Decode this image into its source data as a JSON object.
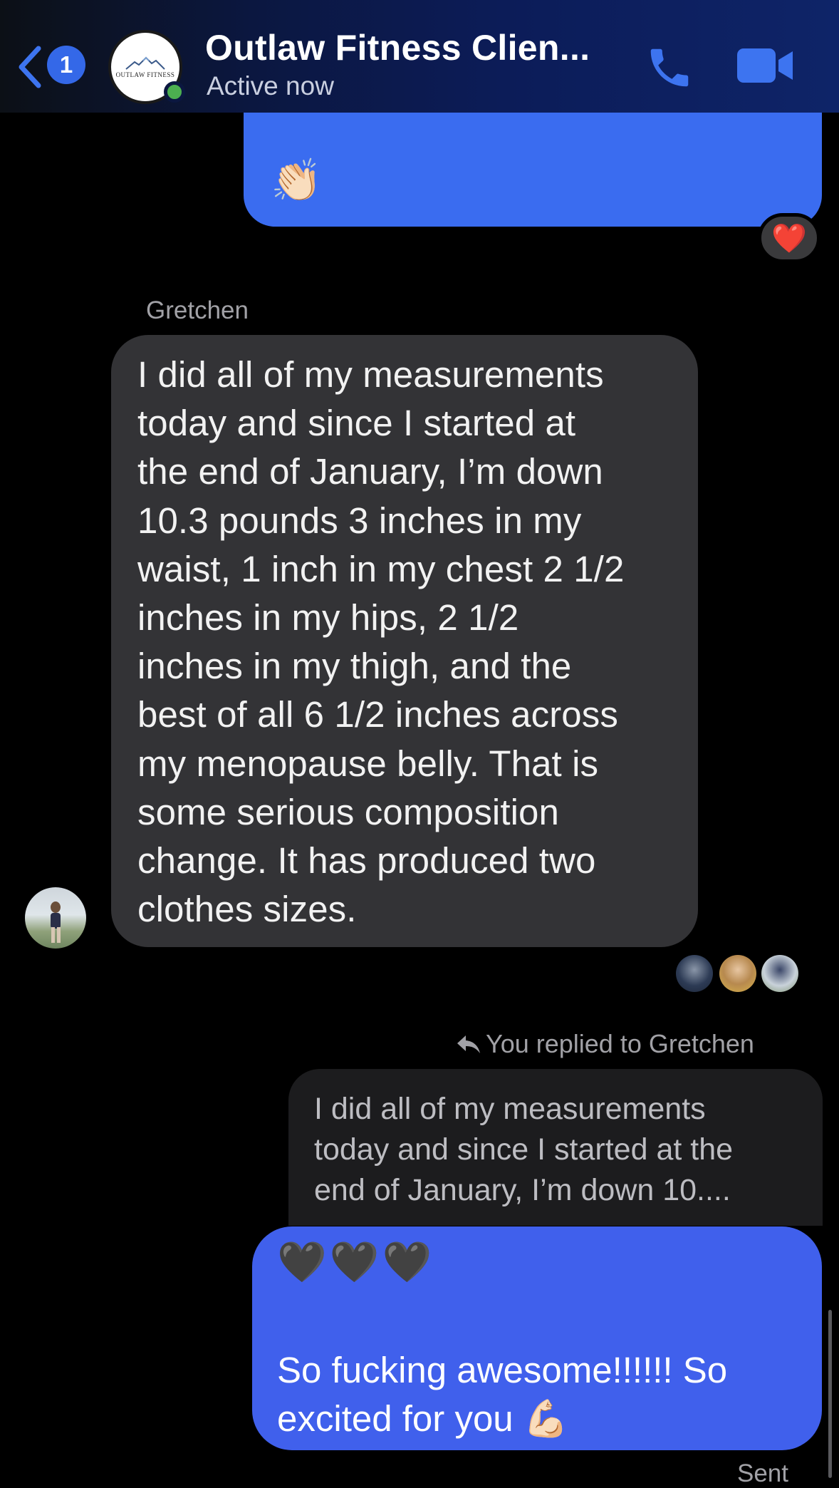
{
  "header": {
    "back_badge": "1",
    "avatar_logo_text": "OUTLAW FITNESS",
    "title": "Outlaw Fitness Clien...",
    "status": "Active now",
    "icons": {
      "back": "chevron-left-icon",
      "call": "phone-icon",
      "video": "video-camera-icon"
    }
  },
  "messages": {
    "top_outgoing": {
      "emoji": "👏🏻",
      "reaction": "❤️"
    },
    "incoming": {
      "sender": "Gretchen",
      "lines": [
        "I did all of my measurements",
        "today and since I started at",
        "the end of January, I’m down",
        "10.3 pounds 3 inches in my",
        "waist, 1 inch in my chest 2 1/2",
        "inches in my hips, 2 1/2",
        "inches in my thigh, and the",
        "best of all 6 1/2 inches across",
        "my menopause belly. That is",
        "some serious composition",
        "change. It has produced two",
        "clothes sizes."
      ]
    },
    "reply": {
      "label": "You replied to Gretchen",
      "quoted_lines": [
        "I did all of my measurements",
        "today and since I started at the",
        "end of January, I’m down 10...."
      ],
      "hearts": "🖤🖤🖤",
      "lines": [
        "So fucking awesome!!!!!!  So",
        "excited for you 💪🏻"
      ]
    },
    "status": "Sent"
  },
  "colors": {
    "outgoing_bubble": "#3a6cf0",
    "reply_bubble": "#4060ec",
    "incoming_bubble": "#333336",
    "online": "#4caf50"
  }
}
